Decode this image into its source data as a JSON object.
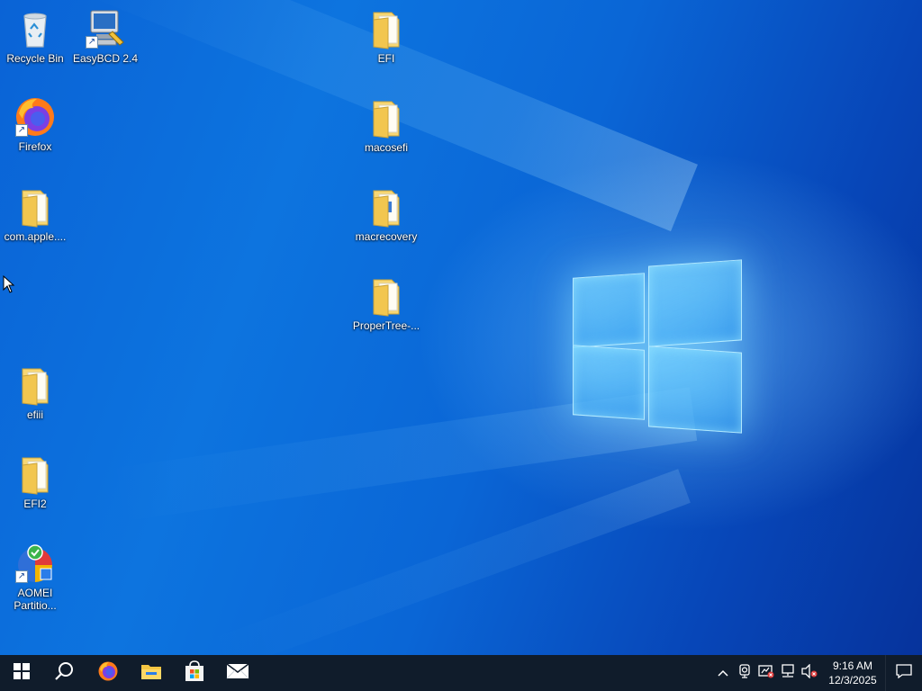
{
  "desktop": {
    "icons": [
      {
        "label": "Recycle Bin",
        "icon": "recycle-bin-icon"
      },
      {
        "label": "EasyBCD 2.4",
        "icon": "easybcd-icon"
      },
      {
        "label": "Firefox",
        "icon": "firefox-icon"
      },
      {
        "label": "com.apple....",
        "icon": "folder-icon"
      },
      {
        "label": "efiii",
        "icon": "folder-icon"
      },
      {
        "label": "EFI2",
        "icon": "folder-icon"
      },
      {
        "label": "AOMEI Partitio...",
        "icon": "aomei-partition-icon"
      },
      {
        "label": "EFI",
        "icon": "folder-icon"
      },
      {
        "label": "macosefi",
        "icon": "folder-icon"
      },
      {
        "label": "macrecovery",
        "icon": "folder-icon"
      },
      {
        "label": "ProperTree-...",
        "icon": "folder-icon"
      }
    ],
    "wallpaper": "windows-10-hero",
    "accent_color": "#0a66d6"
  },
  "taskbar": {
    "start": "windows-start-icon",
    "search": "search-icon",
    "pinned": [
      "firefox-icon",
      "file-explorer-icon",
      "microsoft-store-icon",
      "mail-icon"
    ],
    "tray": [
      "chevron-up-icon",
      "webcam-icon",
      "security-icon",
      "network-icon",
      "volume-muted-icon"
    ],
    "clock": {
      "time": "9:16 AM",
      "date": "12/3/2025"
    },
    "notifications": "action-center-icon",
    "background_color": "#101c2b"
  }
}
